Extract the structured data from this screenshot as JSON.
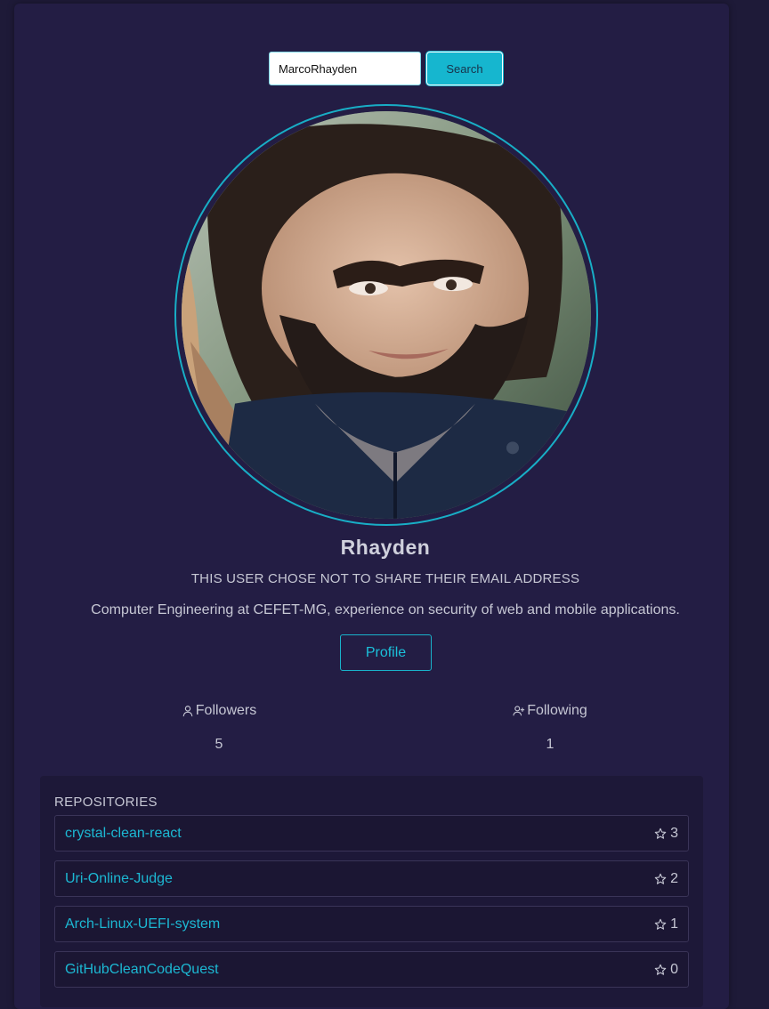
{
  "search": {
    "value": "MarcoRhayden",
    "button_label": "Search"
  },
  "user": {
    "name": "Rhayden",
    "email_notice": "THIS USER CHOSE NOT TO SHARE THEIR EMAIL ADDRESS",
    "bio": "Computer Engineering at CEFET-MG, experience on security of web and mobile applications.",
    "profile_button": "Profile"
  },
  "stats": {
    "followers": {
      "label": "Followers",
      "value": "5",
      "icon": "user-icon"
    },
    "following": {
      "label": "Following",
      "value": "1",
      "icon": "user-plus-icon"
    }
  },
  "repositories": {
    "title": "REPOSITORIES",
    "items": [
      {
        "name": "crystal-clean-react",
        "stars": "3"
      },
      {
        "name": "Uri-Online-Judge",
        "stars": "2"
      },
      {
        "name": "Arch-Linux-UEFI-system",
        "stars": "1"
      },
      {
        "name": "GitHubCleanCodeQuest",
        "stars": "0"
      }
    ]
  },
  "colors": {
    "accent": "#16b6cf",
    "background": "#231d44",
    "text": "#c6c7d4"
  }
}
